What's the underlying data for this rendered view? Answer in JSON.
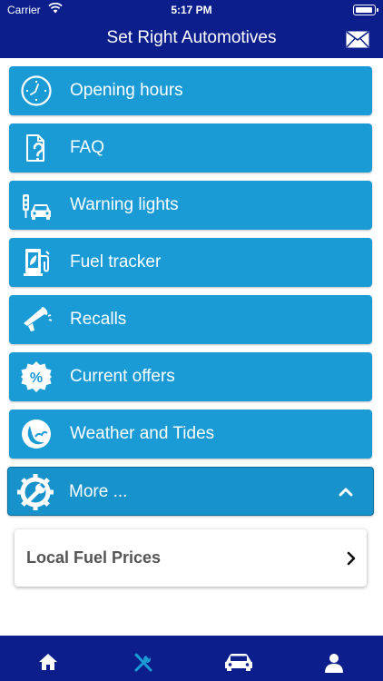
{
  "status_bar": {
    "carrier": "Carrier",
    "time": "5:17 PM"
  },
  "header": {
    "title": "Set Right Automotives",
    "mail_icon": "mail-icon"
  },
  "menu": [
    {
      "label": "Opening hours",
      "icon": "clock-icon"
    },
    {
      "label": "FAQ",
      "icon": "faq-document-icon"
    },
    {
      "label": "Warning lights",
      "icon": "traffic-light-car-icon"
    },
    {
      "label": "Fuel tracker",
      "icon": "fuel-pump-icon"
    },
    {
      "label": "Recalls",
      "icon": "megaphone-icon"
    },
    {
      "label": "Current offers",
      "icon": "percent-badge-icon"
    },
    {
      "label": "Weather and Tides",
      "icon": "weather-icon"
    }
  ],
  "more": {
    "label": "More ...",
    "icon": "gear-wrench-icon",
    "expanded": true
  },
  "submenu": [
    {
      "label": "Local Fuel Prices"
    }
  ],
  "tabbar": {
    "tabs": [
      {
        "icon": "home-icon",
        "active": false
      },
      {
        "icon": "tools-icon",
        "active": true
      },
      {
        "icon": "car-icon",
        "active": false
      },
      {
        "icon": "profile-icon",
        "active": false
      }
    ],
    "active_color": "#1a9bd6"
  },
  "colors": {
    "nav_bar": "#0b1e8c",
    "menu_item": "#1a9bd6"
  }
}
